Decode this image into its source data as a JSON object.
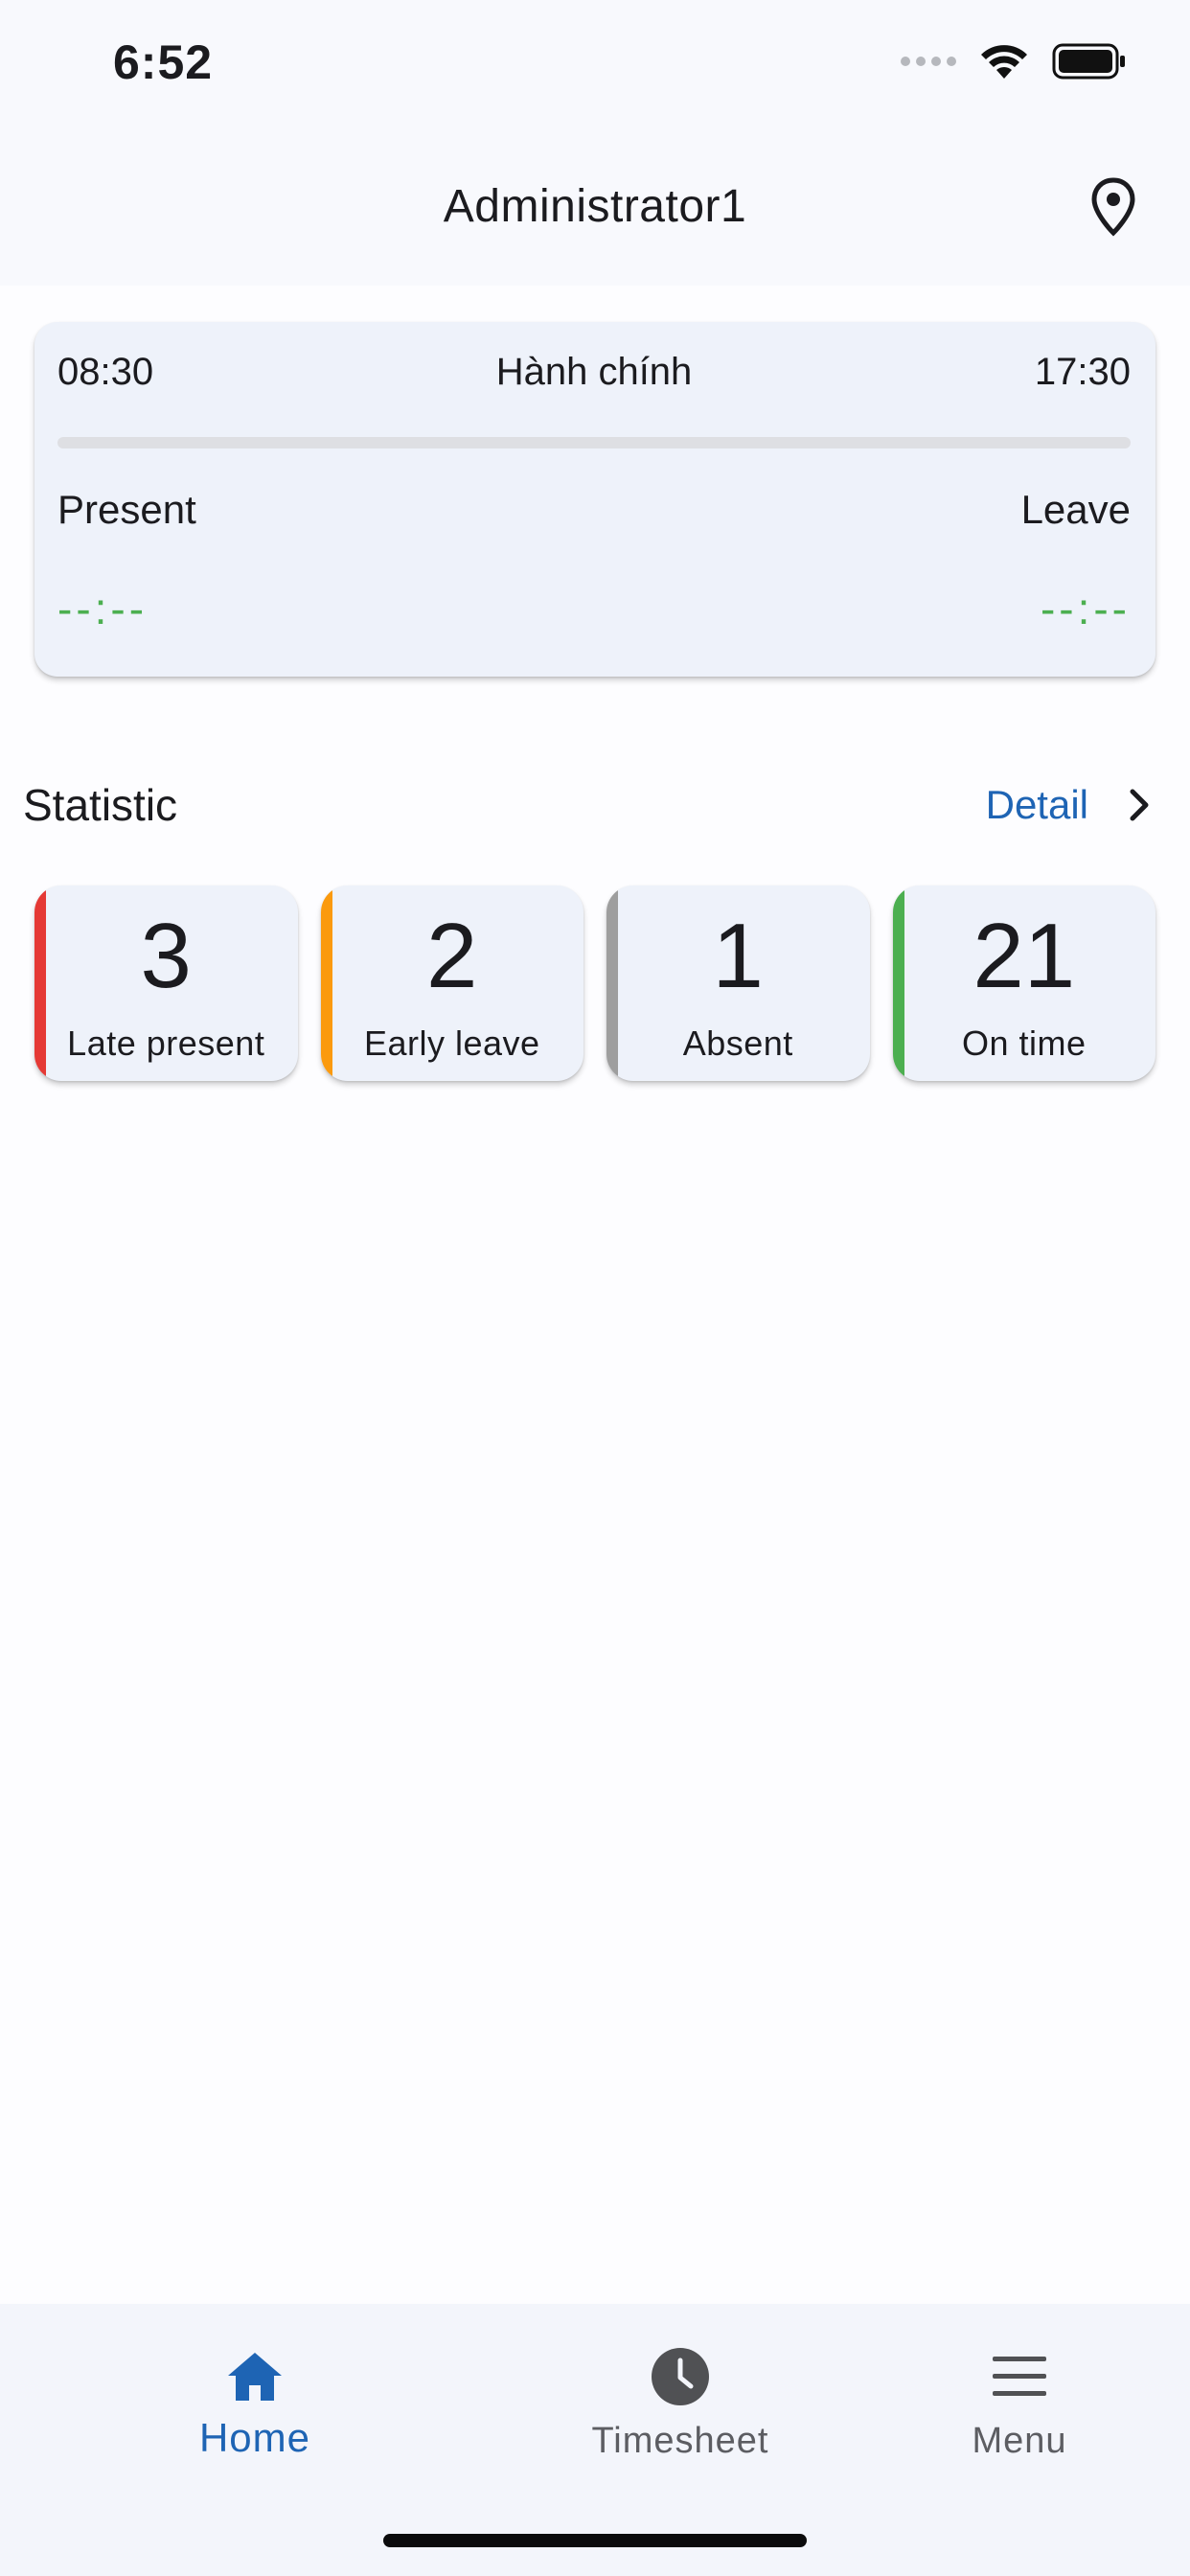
{
  "status_bar": {
    "time": "6:52"
  },
  "app_bar": {
    "title": "Administrator1",
    "location_icon": "location-pin-icon"
  },
  "shift": {
    "start": "08:30",
    "name": "Hành chính",
    "end": "17:30",
    "present_label": "Present",
    "leave_label": "Leave",
    "present_time": "--:--",
    "leave_time": "--:--"
  },
  "statistic": {
    "title": "Statistic",
    "detail_label": "Detail",
    "cards": [
      {
        "value": "3",
        "label": "Late present",
        "color": "#e53935"
      },
      {
        "value": "2",
        "label": "Early leave",
        "color": "#fb9a0e"
      },
      {
        "value": "1",
        "label": "Absent",
        "color": "#9e9e9e"
      },
      {
        "value": "21",
        "label": "On time",
        "color": "#4caf50"
      }
    ]
  },
  "bottom_nav": {
    "items": [
      {
        "label": "Home",
        "icon": "home-icon",
        "active": true
      },
      {
        "label": "Timesheet",
        "icon": "clock-icon",
        "active": false
      },
      {
        "label": "Menu",
        "icon": "menu-icon",
        "active": false
      }
    ]
  },
  "colors": {
    "accent": "#1e64b4",
    "success": "#4caf50"
  }
}
